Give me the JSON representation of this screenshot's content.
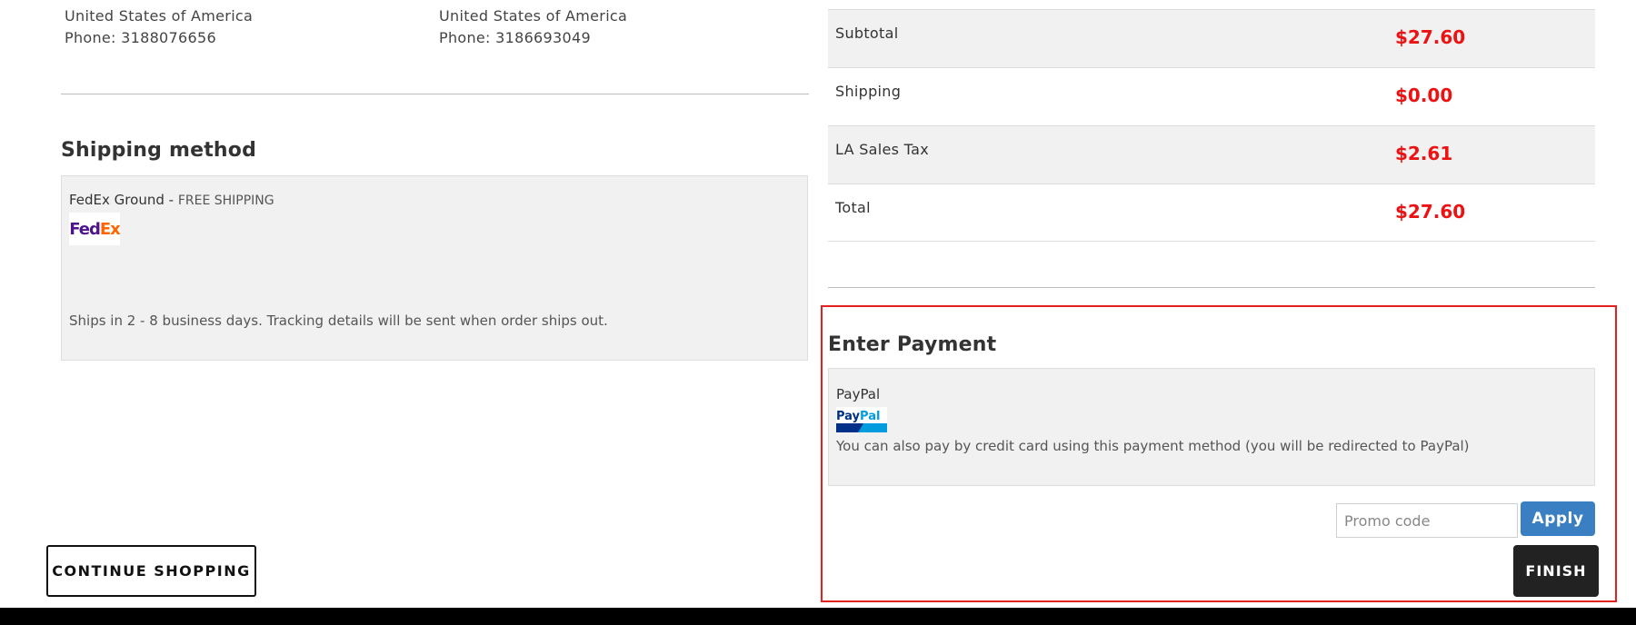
{
  "billing_address": {
    "country": "United States of America",
    "phone": "Phone: 3188076656"
  },
  "shipping_address": {
    "country": "United States of America",
    "phone": "Phone: 3186693049"
  },
  "shipping_method": {
    "title": "Shipping method",
    "carrier": "FedEx Ground",
    "separator": " - ",
    "price_label": "FREE SHIPPING",
    "logo_text_a": "Fed",
    "logo_text_b": "Ex",
    "note": "Ships in 2 - 8 business days. Tracking details will be sent when order ships out."
  },
  "summary": {
    "rows": [
      {
        "label": "Subtotal",
        "value": "$27.60"
      },
      {
        "label": "Shipping",
        "value": "$0.00"
      },
      {
        "label": "LA Sales Tax",
        "value": "$2.61"
      },
      {
        "label": "Total",
        "value": "$27.60"
      }
    ]
  },
  "payment": {
    "title": "Enter Payment",
    "method_name": "PayPal",
    "logo_text_a": "Pay",
    "logo_text_b": "Pal",
    "note": "You can also pay by credit card using this payment method (you will be redirected to PayPal)",
    "promo_placeholder": "Promo code",
    "apply_label": "Apply",
    "finish_label": "FINISH"
  },
  "actions": {
    "continue_label": "CONTINUE SHOPPING"
  },
  "colors": {
    "price_red": "#ee1111",
    "apply_blue": "#3a7fc1",
    "highlight_outline": "#e52020"
  }
}
